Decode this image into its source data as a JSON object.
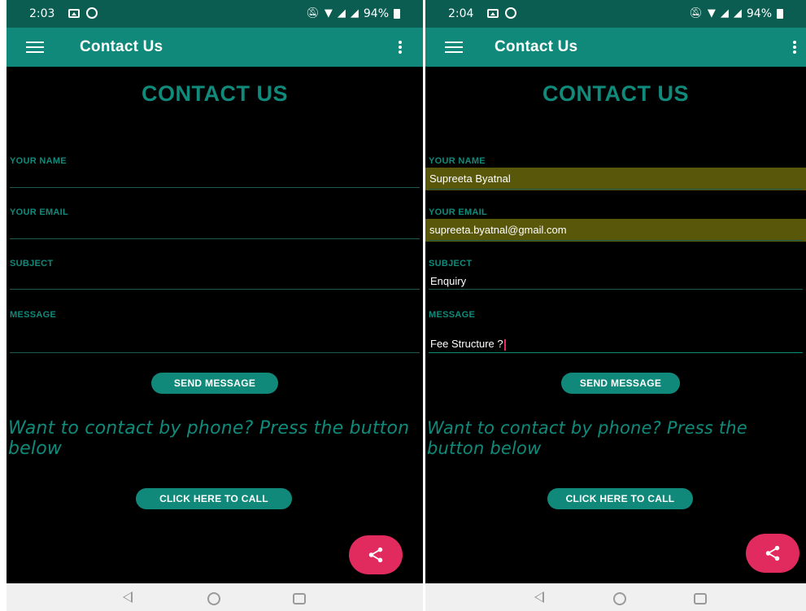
{
  "left": {
    "status": {
      "time": "2:03",
      "battery": "94%"
    },
    "appbar": {
      "title": "Contact Us"
    },
    "heading": "CONTACT US",
    "fields": [
      {
        "label": "YOUR NAME",
        "value": ""
      },
      {
        "label": "YOUR EMAIL",
        "value": ""
      },
      {
        "label": "SUBJECT",
        "value": ""
      },
      {
        "label": "MESSAGE",
        "value": ""
      }
    ],
    "send_button": "SEND MESSAGE",
    "phone_prompt": "Want to contact by phone? Press the button below",
    "call_button": "CLICK HERE TO CALL"
  },
  "right": {
    "status": {
      "time": "2:04",
      "battery": "94%"
    },
    "appbar": {
      "title": "Contact Us"
    },
    "heading": "CONTACT US",
    "fields": [
      {
        "label": "YOUR NAME",
        "value": "Supreeta Byatnal"
      },
      {
        "label": "YOUR EMAIL",
        "value": "supreeta.byatnal@gmail.com"
      },
      {
        "label": "SUBJECT",
        "value": "Enquiry"
      },
      {
        "label": "MESSAGE",
        "value": "Fee Structure ?"
      }
    ],
    "send_button": "SEND MESSAGE",
    "phone_prompt": "Want to contact by phone? Press the button below",
    "call_button": "CLICK HERE TO CALL"
  },
  "colors": {
    "status_bar": "#0b5d52",
    "app_bar": "#11897a",
    "accent_teal": "#0f8a7b",
    "fab": "#e12a5d",
    "autofill_highlight": "#58570a",
    "background": "#000000"
  },
  "icons": [
    "menu-icon",
    "overflow-menu-icon",
    "share-icon",
    "back-icon",
    "home-icon",
    "recents-icon",
    "image-icon",
    "whatsapp-icon",
    "mute-icon",
    "wifi-icon",
    "signal-icon",
    "battery-icon"
  ]
}
